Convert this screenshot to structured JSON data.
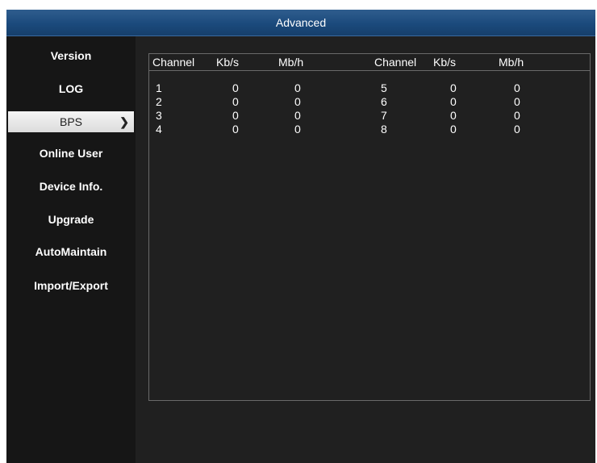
{
  "window": {
    "title": "Advanced"
  },
  "sidebar": {
    "items": [
      {
        "label": "Version"
      },
      {
        "label": "LOG"
      },
      {
        "label": "BPS",
        "active": true,
        "icon": "chevron-right-icon"
      },
      {
        "label": "Online User"
      },
      {
        "label": "Device Info."
      },
      {
        "label": "Upgrade"
      },
      {
        "label": "AutoMaintain"
      },
      {
        "label": "Import/Export"
      }
    ]
  },
  "bps_table": {
    "columns": [
      "Channel",
      "Kb/s",
      "Mb/h",
      "Channel",
      "Kb/s",
      "Mb/h"
    ],
    "rows": [
      [
        "1",
        "0",
        "0",
        "5",
        "0",
        "0"
      ],
      [
        "2",
        "0",
        "0",
        "6",
        "0",
        "0"
      ],
      [
        "3",
        "0",
        "0",
        "7",
        "0",
        "0"
      ],
      [
        "4",
        "0",
        "0",
        "8",
        "0",
        "0"
      ]
    ]
  }
}
